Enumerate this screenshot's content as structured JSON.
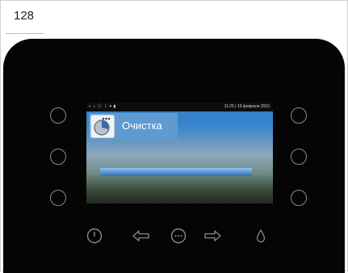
{
  "page": {
    "number": "128"
  },
  "device": {
    "status_bar": {
      "icons": "◐ ⌂ ⓘ ⌇ ▾ ▮",
      "datetime": "11:25 | 19 февраля 2015"
    },
    "screen": {
      "title": "Очистка",
      "icon": "cleaning-drum-icon",
      "progress": 1.0
    },
    "side_buttons_left": [
      "left-button-1",
      "left-button-2",
      "left-button-3"
    ],
    "side_buttons_right": [
      "right-button-1",
      "right-button-2",
      "right-button-3"
    ],
    "bottom_buttons": [
      "power-icon",
      "arrow-left-icon",
      "menu-dots-icon",
      "arrow-right-icon",
      "drop-icon"
    ]
  },
  "colors": {
    "bezel": "#050505",
    "screen_top": "#2f7bc6",
    "button_outline": "#8a8a8a"
  }
}
